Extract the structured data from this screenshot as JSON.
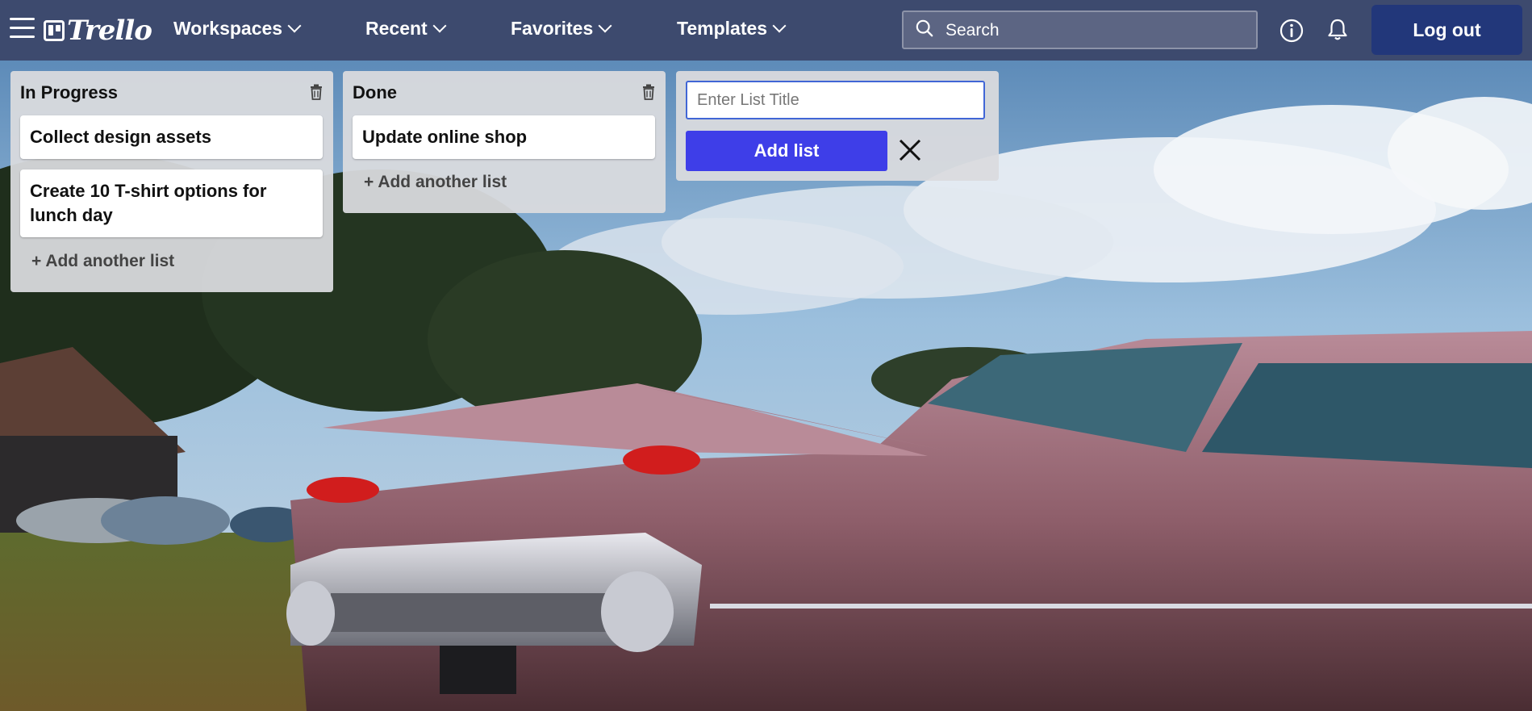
{
  "colors": {
    "topbar": "#3d4a6e",
    "logout_button": "#22377a",
    "add_list_button": "#3e3ee8",
    "list_background": "#dadbde"
  },
  "header": {
    "logo_text": "Trello",
    "nav": [
      {
        "label": "Workspaces"
      },
      {
        "label": "Recent"
      },
      {
        "label": "Favorites"
      },
      {
        "label": "Templates"
      }
    ],
    "search": {
      "placeholder": "Search"
    },
    "icons": [
      "menu-icon",
      "search-icon",
      "info-icon",
      "bell-icon"
    ],
    "logout_label": "Log out"
  },
  "board": {
    "lists": [
      {
        "title": "In Progress",
        "cards": [
          {
            "text": "Collect design assets"
          },
          {
            "text": "Create 10 T-shirt options for lunch day"
          }
        ],
        "add_label": "+ Add another list"
      },
      {
        "title": "Done",
        "cards": [
          {
            "text": "Update online shop"
          }
        ],
        "add_label": "+ Add another list"
      }
    ],
    "composer": {
      "placeholder": "Enter List Title",
      "add_label": "Add list"
    }
  }
}
